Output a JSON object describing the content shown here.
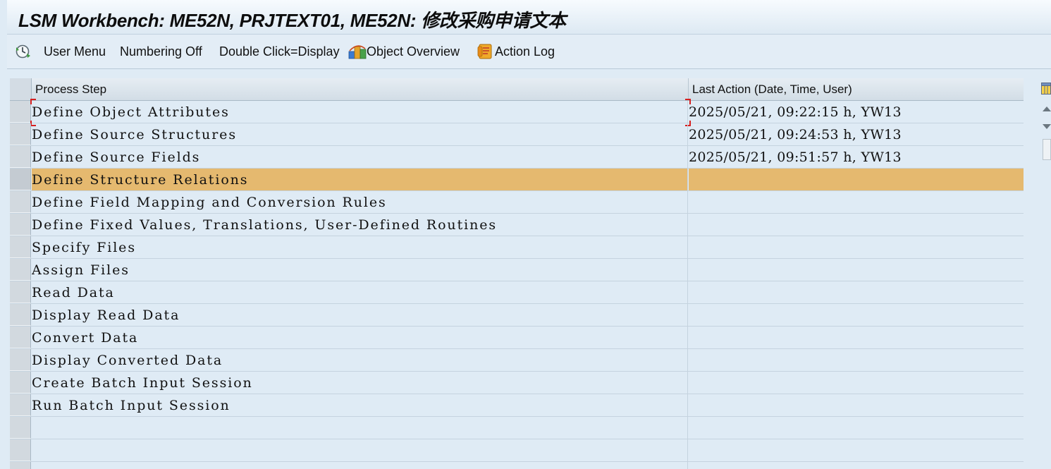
{
  "window": {
    "title": "LSM Workbench: ME52N, PRJTEXT01, ME52N: 修改采购申请文本"
  },
  "toolbar": {
    "items": [
      {
        "label": "User Menu",
        "icon": "clock-refresh-icon"
      },
      {
        "label": "Numbering Off"
      },
      {
        "label": "Double Click=Display"
      },
      {
        "label": "Object Overview",
        "icon": "object-overview-icon"
      },
      {
        "label": "Action Log",
        "icon": "action-log-icon"
      }
    ]
  },
  "table": {
    "headers": {
      "step": "Process Step",
      "last_action": "Last Action (Date, Time, User)"
    },
    "rows": [
      {
        "step": "Define Object Attributes",
        "last_action": "2025/05/21, 09:22:15 h, YW13"
      },
      {
        "step": "Define Source Structures",
        "last_action": "2025/05/21, 09:24:53 h, YW13"
      },
      {
        "step": "Define Source Fields",
        "last_action": "2025/05/21, 09:51:57 h, YW13"
      },
      {
        "step": "Define Structure Relations",
        "last_action": "",
        "highlighted": true
      },
      {
        "step": "Define Field Mapping and Conversion Rules",
        "last_action": ""
      },
      {
        "step": "Define Fixed Values, Translations, User-Defined Routines",
        "last_action": ""
      },
      {
        "step": "Specify Files",
        "last_action": ""
      },
      {
        "step": "Assign Files",
        "last_action": ""
      },
      {
        "step": "Read Data",
        "last_action": ""
      },
      {
        "step": "Display Read Data",
        "last_action": ""
      },
      {
        "step": "Convert Data",
        "last_action": ""
      },
      {
        "step": "Display Converted Data",
        "last_action": ""
      },
      {
        "step": "Create Batch Input Session",
        "last_action": ""
      },
      {
        "step": "Run Batch Input Session",
        "last_action": ""
      },
      {
        "step": "",
        "last_action": ""
      },
      {
        "step": "",
        "last_action": ""
      },
      {
        "step": "",
        "last_action": ""
      }
    ]
  },
  "colors": {
    "highlight_row": "#e5b96f",
    "background": "#dfebf5",
    "focus_marker": "#d62020"
  }
}
